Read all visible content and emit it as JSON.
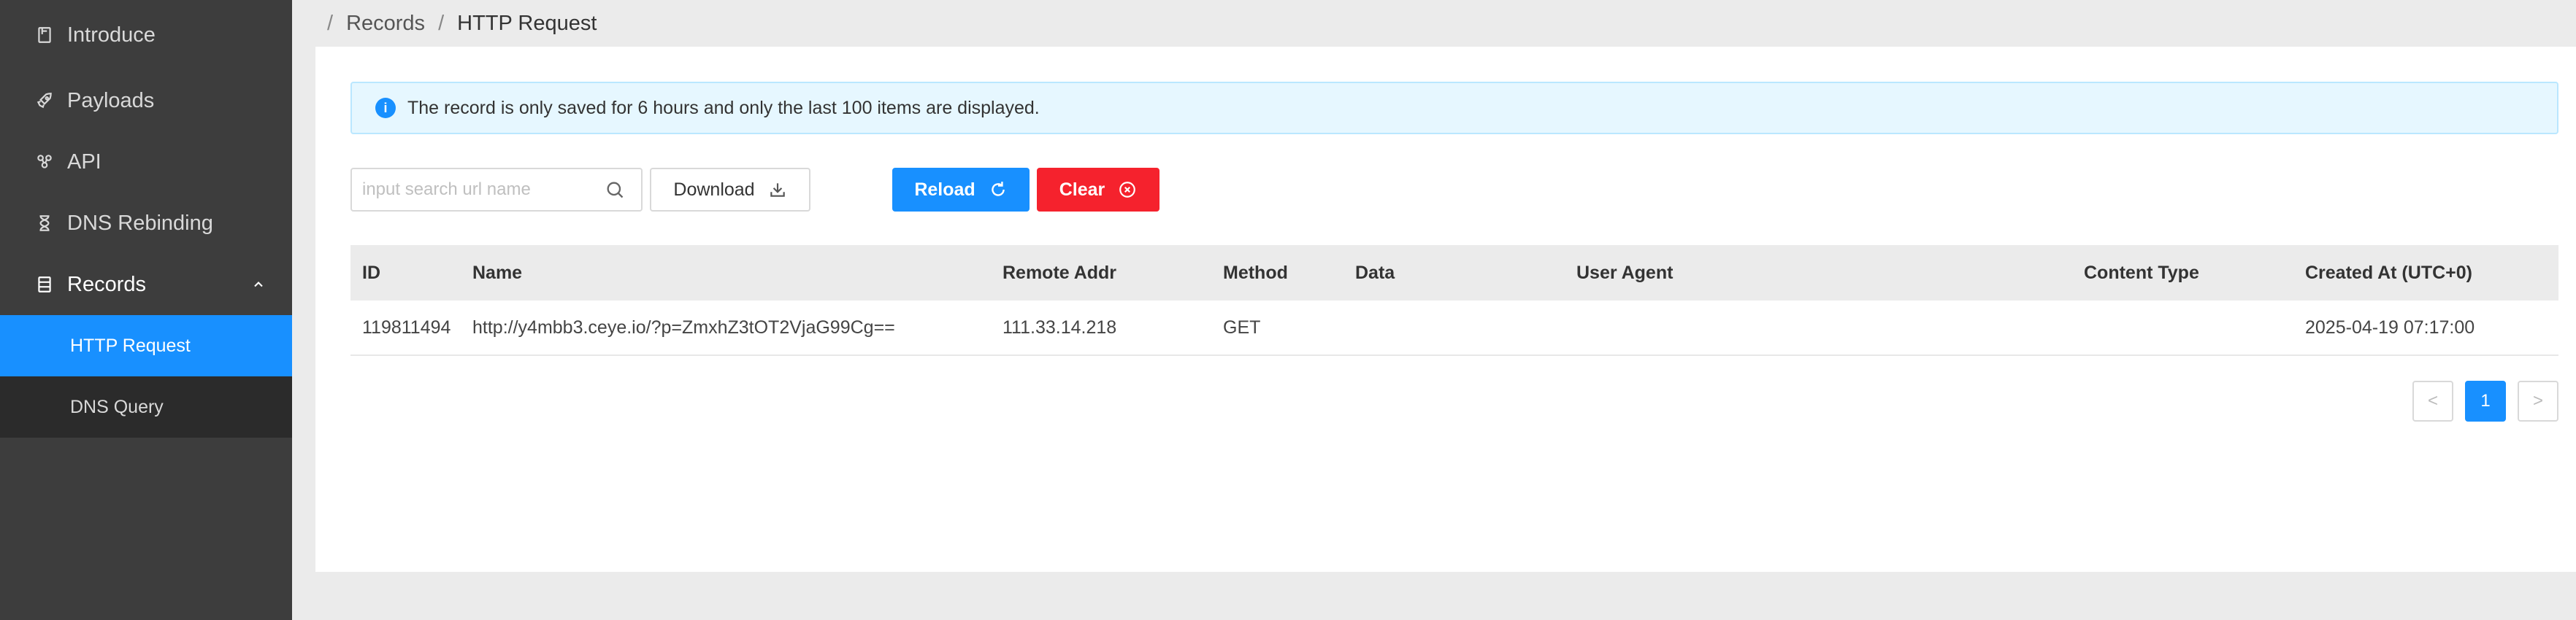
{
  "sidebar": {
    "items": [
      {
        "label": "Introduce",
        "icon": "book-icon"
      },
      {
        "label": "Payloads",
        "icon": "rocket-icon"
      },
      {
        "label": "API",
        "icon": "api-icon"
      },
      {
        "label": "DNS Rebinding",
        "icon": "hourglass-icon"
      },
      {
        "label": "Records",
        "icon": "database-icon",
        "open": true
      }
    ],
    "submenu": [
      {
        "label": "HTTP Request",
        "active": true
      },
      {
        "label": "DNS Query",
        "active": false
      }
    ]
  },
  "breadcrumb": {
    "separator": "/",
    "items": [
      "Records",
      "HTTP Request"
    ]
  },
  "alert": {
    "icon_text": "i",
    "message": "The record is only saved for 6 hours and only the last 100 items are displayed."
  },
  "toolbar": {
    "search_placeholder": "input search url name",
    "download_label": "Download",
    "reload_label": "Reload",
    "clear_label": "Clear"
  },
  "table": {
    "columns": [
      "ID",
      "Name",
      "Remote Addr",
      "Method",
      "Data",
      "User Agent",
      "Content Type",
      "Created At (UTC+0)"
    ],
    "rows": [
      [
        "119811494",
        "http://y4mbb3.ceye.io/?p=ZmxhZ3tOT2VjaG99Cg==",
        "111.33.14.218",
        "GET",
        "",
        "",
        "",
        "2025-04-19 07:17:00"
      ]
    ]
  },
  "pagination": {
    "prev": "<",
    "current": "1",
    "next": ">"
  },
  "colors": {
    "sidebar_bg": "#3d3d3d",
    "accent": "#1890ff",
    "danger": "#f5222d"
  }
}
